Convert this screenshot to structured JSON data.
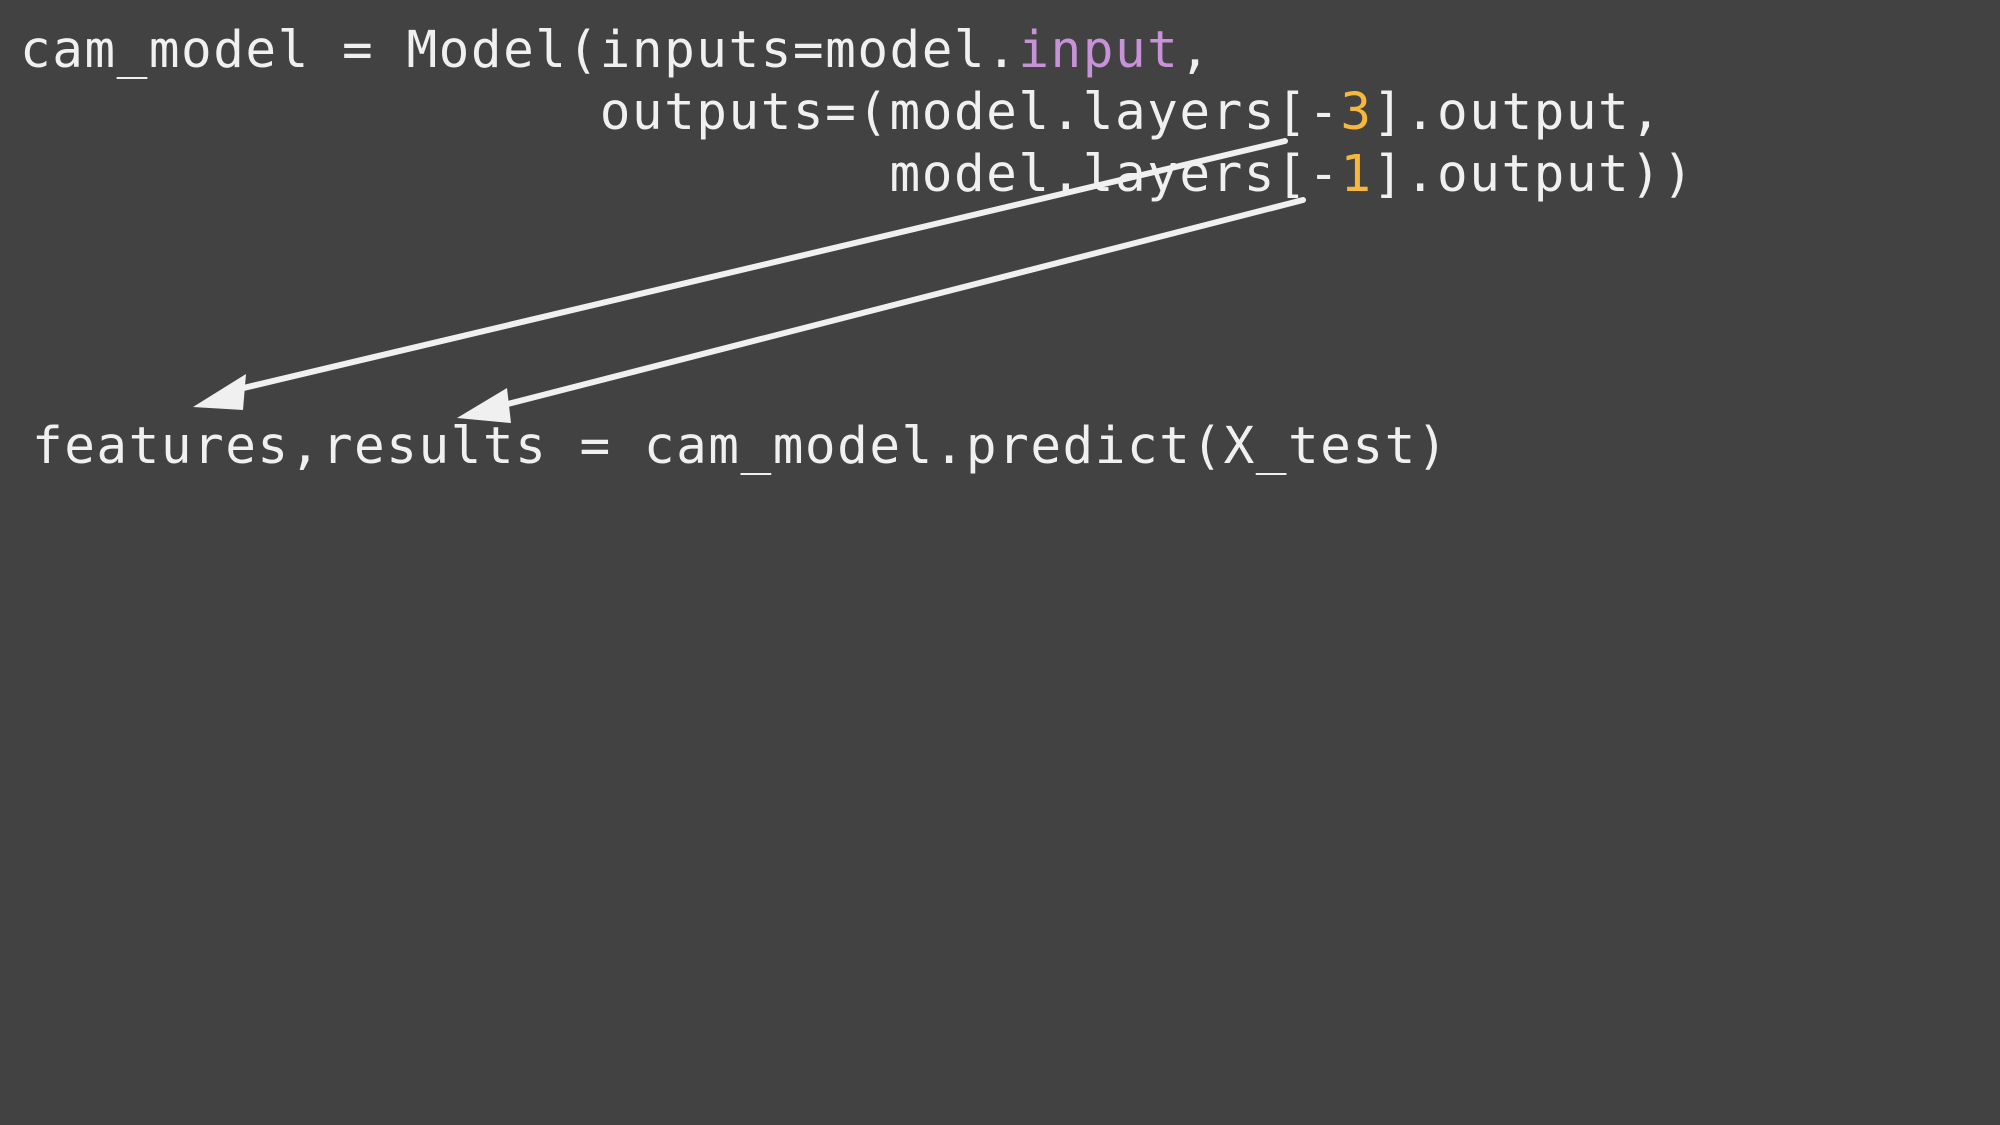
{
  "code_top": {
    "line1": {
      "prefix": "cam_model = Model(inputs=model.",
      "highlight": "input",
      "suffix": ","
    },
    "line2": {
      "indent": "                  ",
      "prefix": "outputs=(model.layers[-",
      "number": "3",
      "suffix": "].output,"
    },
    "line3": {
      "indent": "                           ",
      "prefix": "model.layers[-",
      "number": "1",
      "suffix": "].output))"
    }
  },
  "code_bottom": {
    "line": "features,results = cam_model.predict(X_test)"
  },
  "colors": {
    "background": "#424242",
    "text": "#f0f0f0",
    "attribute_highlight": "#c792d8",
    "number_highlight": "#f6b73c",
    "arrow": "#f0f0f0"
  },
  "arrows": [
    {
      "from": "model.layers[-3].output",
      "to": "features"
    },
    {
      "from": "model.layers[-1].output",
      "to": "results"
    }
  ]
}
